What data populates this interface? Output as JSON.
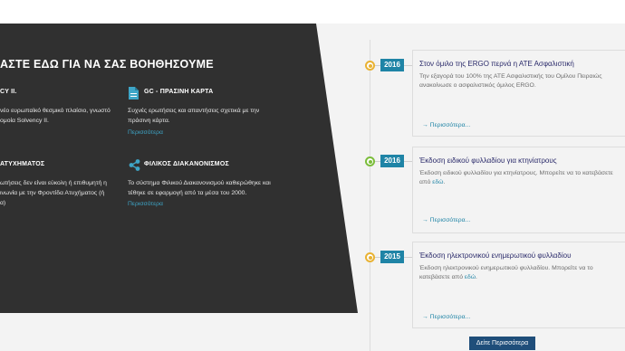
{
  "help_panel": {
    "title": "ΑΣΤΕ ΕΔΩ ΓΙΑ ΝΑ ΣΑΣ ΒΟΗΘΗΣΟΥΜΕ",
    "items": [
      {
        "title": "CY II.",
        "lines": [
          "νέο ευρωπαϊκό θεσμικό πλαίσιο, γνωστό",
          "ομοία Solvency II."
        ],
        "link": ""
      },
      {
        "title": "GC - ΠΡΑΣΙΝΗ ΚΑΡΤΑ",
        "lines": [
          "Συχνές ερωτήσεις και απαντήσεις σχετικά με την",
          "πράσινη κάρτα."
        ],
        "link": "Περισσότερα"
      },
      {
        "title": "ΑΤΥΧΗΜΑΤΟΣ",
        "lines": [
          "ωτήσεις δεν είναι εύκολη ή επιθυμητή η",
          "ινωνία με την Φροντίδα Ατυχήματος (ή",
          "α)"
        ],
        "link": ""
      },
      {
        "title": "ΦΙΛΙΚΟΣ ΔΙΑΚΑΝΟΝΙΣΜΟΣ",
        "lines": [
          "Το σύστημα Φιλικού Διακανονισμού καθιερώθηκε και",
          "τέθηκε σε εφαρμογή από τα μέσα του 2000."
        ],
        "link": "Περισσότερα"
      }
    ]
  },
  "timeline": {
    "entries": [
      {
        "year": "2016",
        "dot_color": "#e9b233",
        "title": "Στον όμιλο της ERGO περνά η ΑΤΕ Ασφαλιστική",
        "desc_lines": [
          "Την εξαγορά του 100% της ΑΤΕ Ασφαλιστικής του Ομίλου Πειραιώς",
          "ανακοίνωσε ο ασφαλιστικός όμιλος ERGO."
        ],
        "desc_link": "",
        "more": "→ Περισσότερα..."
      },
      {
        "year": "2016",
        "dot_color": "#7bbd3b",
        "title": "Έκδοση ειδικού φυλλαδίου για κτηνίατρους",
        "desc_lines": [
          "Έκδοση ειδικού φυλλαδίου για κτηνίατρους. Μπορείτε να το κατεβάσετε"
        ],
        "desc_prefix": "από ",
        "desc_link": "εδώ",
        "desc_suffix": ".",
        "more": "→ Περισσότερα..."
      },
      {
        "year": "2015",
        "dot_color": "#e9b233",
        "title": "Έκδοση ηλεκτρονικού ενημερωτικού φυλλαδίου",
        "desc_lines": [
          "Έκδοση ηλεκτρονικού ενημερωτικού φυλλαδίου. Μπορείτε να το"
        ],
        "desc_prefix": "κατεβάσετε από ",
        "desc_link": "εδώ",
        "desc_suffix": ".",
        "more": "→ Περισσότερα..."
      }
    ],
    "see_more_button": "Δείτε Περισσότερα"
  },
  "icons": {
    "item2": "document-icon",
    "item4": "share-icon"
  }
}
